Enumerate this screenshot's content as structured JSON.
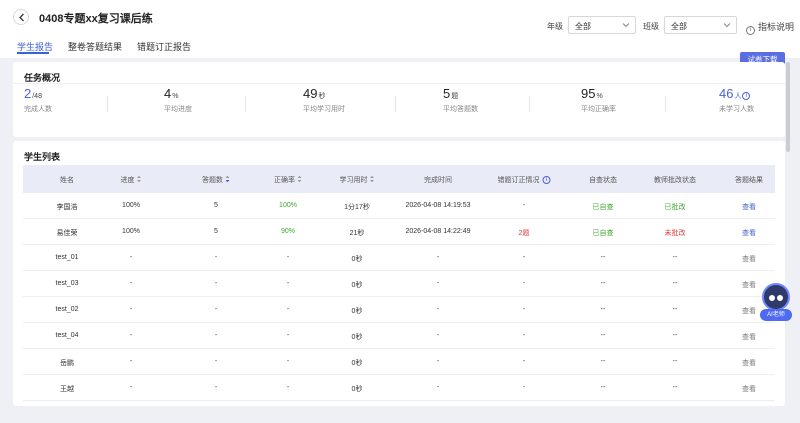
{
  "header": {
    "title": "0408专题xx复习课后练",
    "grade_label": "年级",
    "grade_value": "全部",
    "class_label": "班级",
    "class_value": "全部",
    "help_label": "指标说明",
    "download_label": "试卷下载"
  },
  "tabs": [
    {
      "label": "学生报告",
      "active": true
    },
    {
      "label": "整卷答题结果",
      "active": false
    },
    {
      "label": "错题订正报告",
      "active": false
    }
  ],
  "overview": {
    "title": "任务概况",
    "stats": [
      {
        "value": "2",
        "unit": "/48",
        "label": "完成人数"
      },
      {
        "value": "4",
        "unit": "%",
        "label": "平均进度"
      },
      {
        "value": "49",
        "unit": "秒",
        "label": "平均学习用时"
      },
      {
        "value": "5",
        "unit": "题",
        "label": "平均答题数"
      },
      {
        "value": "95",
        "unit": "%",
        "label": "平均正确率"
      },
      {
        "value": "46",
        "unit": "人",
        "label": "未学习人数"
      }
    ]
  },
  "student_list": {
    "title": "学生列表",
    "columns": [
      "姓名",
      "进度",
      "答题数",
      "正确率",
      "学习用时",
      "完成时间",
      "错题订正情况",
      "自查状态",
      "教师批改状态",
      "答题结果"
    ],
    "rows": [
      [
        "李国浩",
        "100%",
        "5",
        "100%",
        "1分17秒",
        "2026-04-08 14:19:53",
        "-",
        "已自查",
        "已批改",
        "查看"
      ],
      [
        "易佳荣",
        "100%",
        "5",
        "90%",
        "21秒",
        "2026-04-08 14:22:49",
        "2题",
        "已自查",
        "未批改",
        "查看"
      ],
      [
        "test_01",
        "-",
        "-",
        "-",
        "0秒",
        "-",
        "-",
        "--",
        "--",
        "查看"
      ],
      [
        "test_03",
        "-",
        "-",
        "-",
        "0秒",
        "-",
        "-",
        "--",
        "--",
        "查看"
      ],
      [
        "test_02",
        "-",
        "-",
        "-",
        "0秒",
        "-",
        "-",
        "--",
        "--",
        "查看"
      ],
      [
        "test_04",
        "-",
        "-",
        "-",
        "0秒",
        "-",
        "-",
        "--",
        "--",
        "查看"
      ],
      [
        "岳鹏",
        "-",
        "-",
        "-",
        "0秒",
        "-",
        "-",
        "--",
        "--",
        "查看"
      ],
      [
        "王越",
        "-",
        "-",
        "-",
        "0秒",
        "-",
        "-",
        "--",
        "--",
        "查看"
      ]
    ]
  },
  "assistant": {
    "label": "AI老师"
  },
  "colors": {
    "accent": "#3d5fd6",
    "green": "#3ea82f",
    "red": "#e03b3b"
  }
}
